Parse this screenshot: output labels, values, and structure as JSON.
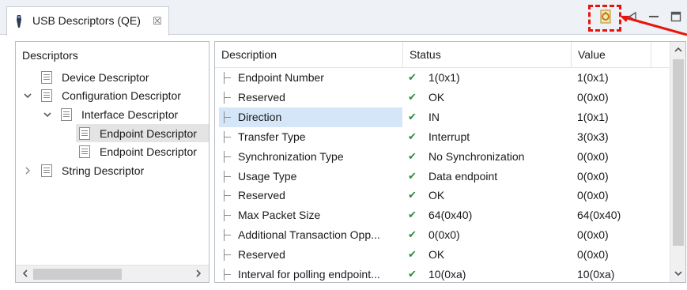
{
  "tab": {
    "title": "USB Descriptors (QE)",
    "close_glyph": "☒"
  },
  "toolbar": {
    "icons": [
      "qe-refresh-icon",
      "pin-icon",
      "minimize-icon",
      "maximize-icon"
    ],
    "highlight_color": "#e8140c"
  },
  "left_pane": {
    "header": "Descriptors",
    "items": [
      {
        "label": "Device Descriptor",
        "level": 0,
        "twisty": ""
      },
      {
        "label": "Configuration Descriptor",
        "level": 0,
        "twisty": "expanded"
      },
      {
        "label": "Interface Descriptor",
        "level": 1,
        "twisty": "expanded"
      },
      {
        "label": "Endpoint Descriptor",
        "level": 2,
        "twisty": "",
        "selected": true
      },
      {
        "label": "Endpoint Descriptor",
        "level": 2,
        "twisty": ""
      },
      {
        "label": "String Descriptor",
        "level": 0,
        "twisty": "collapsed"
      }
    ]
  },
  "table": {
    "headers": {
      "description": "Description",
      "status": "Status",
      "value": "Value"
    },
    "rows": [
      {
        "description": "Endpoint Number",
        "status": "1(0x1)",
        "value": "1(0x1)"
      },
      {
        "description": "Reserved",
        "status": "OK",
        "value": "0(0x0)"
      },
      {
        "description": "Direction",
        "status": "IN",
        "value": "1(0x1)",
        "selected": true
      },
      {
        "description": "Transfer Type",
        "status": "Interrupt",
        "value": "3(0x3)"
      },
      {
        "description": "Synchronization Type",
        "status": "No Synchronization",
        "value": "0(0x0)"
      },
      {
        "description": "Usage Type",
        "status": "Data endpoint",
        "value": "0(0x0)"
      },
      {
        "description": "Reserved",
        "status": "OK",
        "value": "0(0x0)"
      },
      {
        "description": "Max Packet Size",
        "status": "64(0x40)",
        "value": "64(0x40)"
      },
      {
        "description": "Additional Transaction Opp...",
        "status": "0(0x0)",
        "value": "0(0x0)"
      },
      {
        "description": "Reserved",
        "status": "OK",
        "value": "0(0x0)"
      },
      {
        "description": "Interval for polling endpoint...",
        "status": "10(0xa)",
        "value": "10(0xa)"
      }
    ],
    "status_check_color": "#2e8b3a",
    "selection_color": "#d4e6f7"
  }
}
